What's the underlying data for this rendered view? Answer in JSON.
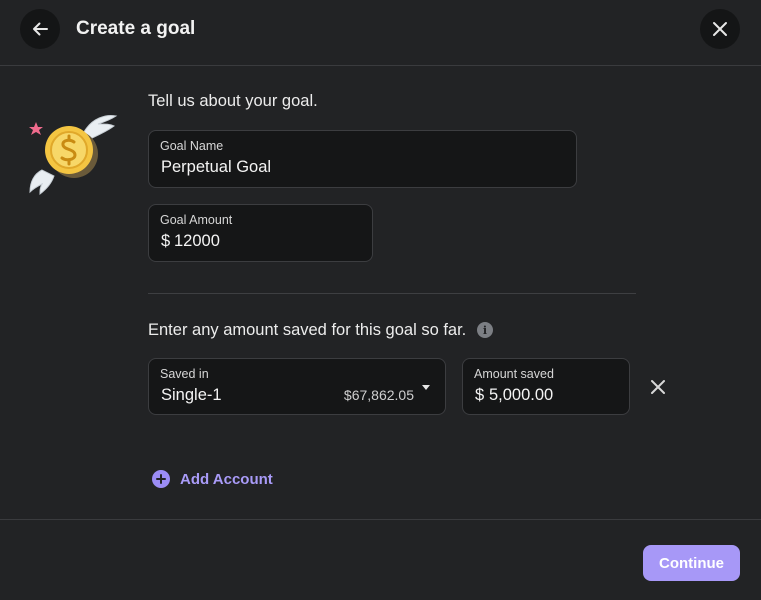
{
  "header": {
    "title": "Create a goal",
    "back_icon": "arrow-left-icon",
    "close_icon": "close-icon"
  },
  "illustration": {
    "icon": "winged-coin-icon"
  },
  "goal_section": {
    "prompt": "Tell us about your goal.",
    "goal_name": {
      "label": "Goal Name",
      "value": "Perpetual Goal"
    },
    "goal_amount": {
      "label": "Goal Amount",
      "prefix": "$",
      "value": "12000"
    }
  },
  "saved_section": {
    "prompt": "Enter any amount saved for this goal so far.",
    "info_icon": "i",
    "saved_in": {
      "label": "Saved in",
      "value": "Single-1",
      "balance": "$67,862.05"
    },
    "amount_saved": {
      "label": "Amount saved",
      "prefix": "$",
      "value": "5,000.00"
    },
    "remove_icon": "close-icon"
  },
  "add_account": {
    "label": "Add Account",
    "icon": "plus-circle-icon"
  },
  "footer": {
    "continue_label": "Continue"
  },
  "colors": {
    "background": "#222325",
    "field_background": "#151617",
    "accent": "#a798f7",
    "accent_text": "#a99bf8"
  }
}
